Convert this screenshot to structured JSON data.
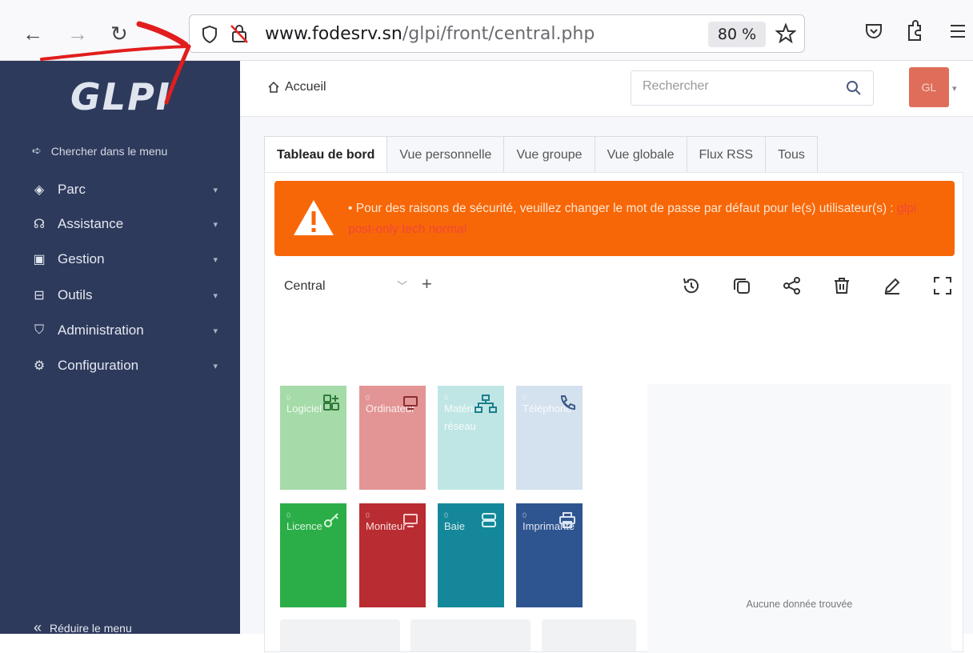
{
  "browser": {
    "url_host": "www.fodesrv.sn",
    "url_path": "/glpi/front/central.php",
    "zoom": "80 %"
  },
  "sidebar": {
    "logo": "GLPI",
    "search_menu": "Chercher dans le menu",
    "items": [
      {
        "label": "Parc",
        "icon": "cube-icon"
      },
      {
        "label": "Assistance",
        "icon": "headset-icon"
      },
      {
        "label": "Gestion",
        "icon": "wallet-icon"
      },
      {
        "label": "Outils",
        "icon": "briefcase-icon"
      },
      {
        "label": "Administration",
        "icon": "shield-check-icon"
      },
      {
        "label": "Configuration",
        "icon": "gear-icon"
      }
    ],
    "reduce": "Réduire le menu"
  },
  "topbar": {
    "breadcrumb": "Accueil",
    "search_placeholder": "Rechercher",
    "avatar": "GL"
  },
  "tabs": [
    "Tableau de bord",
    "Vue personnelle",
    "Vue groupe",
    "Vue globale",
    "Flux RSS",
    "Tous"
  ],
  "alert": {
    "text": "• Pour des raisons de sécurité, veuillez changer le mot de passe par défaut pour le(s) utilisateur(s) : ",
    "users": "glpi post-only tech normal"
  },
  "dashboard": {
    "selected": "Central"
  },
  "tiles": [
    {
      "number": "0",
      "label": "Logiciel",
      "color": "#a5dba8"
    },
    {
      "number": "0",
      "label": "Ordinateur",
      "color": "#e39595"
    },
    {
      "number": "0",
      "label": "Matériel réseau",
      "color": "#bfe6e4"
    },
    {
      "number": "0",
      "label": "Téléphone",
      "color": "#d4e1ee"
    },
    {
      "number": "0",
      "label": "Licence",
      "color": "#2bae48"
    },
    {
      "number": "0",
      "label": "Moniteur",
      "color": "#b92c31"
    },
    {
      "number": "0",
      "label": "Baie",
      "color": "#14889a"
    },
    {
      "number": "0",
      "label": "Imprimante",
      "color": "#2f5590"
    }
  ],
  "no_data": "Aucune donnée trouvée"
}
